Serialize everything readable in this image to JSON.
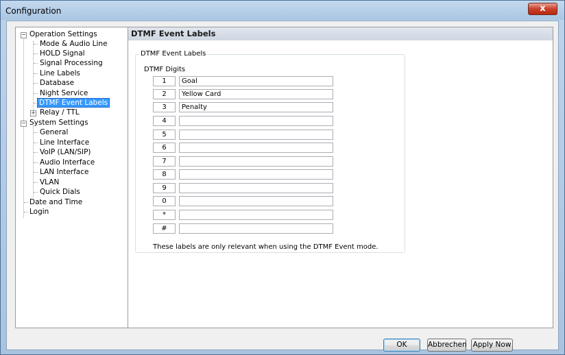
{
  "window": {
    "title": "Configuration",
    "close_label": "x"
  },
  "tree": {
    "operation_settings": "Operation Settings",
    "mode_audio_line": "Mode & Audio Line",
    "hold_signal": "HOLD Signal",
    "signal_processing": "Signal Processing",
    "line_labels": "Line Labels",
    "database": "Database",
    "night_service": "Night Service",
    "dtmf_event_labels": "DTMF Event Labels",
    "relay_ttl": "Relay / TTL",
    "system_settings": "System Settings",
    "general": "General",
    "line_interface": "Line Interface",
    "voip": "VoIP (LAN/SIP)",
    "audio_interface": "Audio Interface",
    "lan_interface": "LAN Interface",
    "vlan": "VLAN",
    "quick_dials": "Quick Dials",
    "date_and_time": "Date and Time",
    "login": "Login"
  },
  "panel": {
    "header": "DTMF Event Labels",
    "group_title": "DTMF Event Labels",
    "digits_title": "DTMF Digits",
    "rows": [
      {
        "digit": "1",
        "label": "Goal"
      },
      {
        "digit": "2",
        "label": "Yellow Card"
      },
      {
        "digit": "3",
        "label": "Penalty"
      },
      {
        "digit": "4",
        "label": ""
      },
      {
        "digit": "5",
        "label": ""
      },
      {
        "digit": "6",
        "label": ""
      },
      {
        "digit": "7",
        "label": ""
      },
      {
        "digit": "8",
        "label": ""
      },
      {
        "digit": "9",
        "label": ""
      },
      {
        "digit": "0",
        "label": ""
      },
      {
        "digit": "*",
        "label": ""
      },
      {
        "digit": "#",
        "label": ""
      }
    ],
    "footnote": "These labels are only relevant when using the DTMF Event mode."
  },
  "buttons": {
    "ok": "OK",
    "cancel": "Abbrechen",
    "apply": "Apply Now"
  }
}
